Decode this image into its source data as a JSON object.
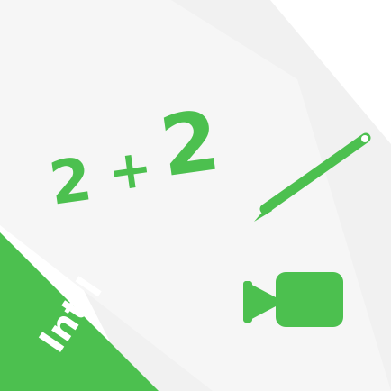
{
  "icon": {
    "equation": {
      "operand_left": "2",
      "operator": "+",
      "operand_right": "2"
    },
    "badge_text": "Int'l",
    "pencil": "pencil-icon",
    "camera": "video-camera-icon"
  },
  "colors": {
    "accent": "#4cc04f",
    "background": "#ffffff",
    "backdrop": "#f1f1f1"
  }
}
